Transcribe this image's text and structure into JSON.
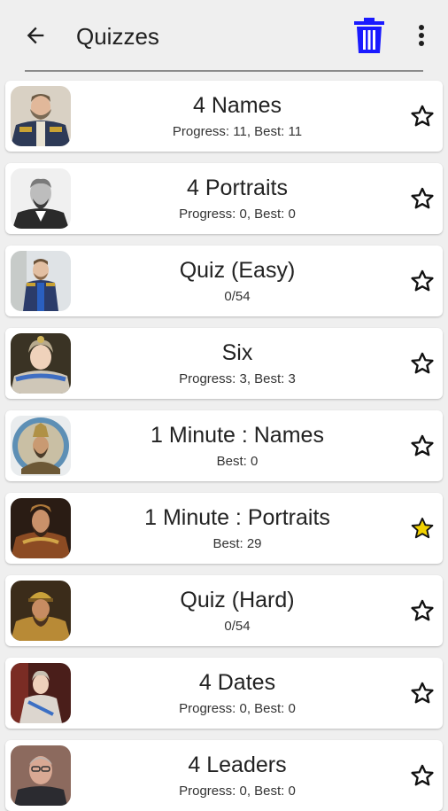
{
  "appbar": {
    "title": "Quizzes",
    "back_icon": "arrow-left-icon",
    "trash_icon": "trash-icon",
    "trash_color": "#1a1aff",
    "menu_icon": "more-vertical-icon"
  },
  "quizzes": [
    {
      "title": "4 Names",
      "subtitle": "Progress: 11, Best: 11",
      "favorite": false
    },
    {
      "title": "4 Portraits",
      "subtitle": "Progress: 0, Best: 0",
      "favorite": false
    },
    {
      "title": "Quiz (Easy)",
      "subtitle": "0/54",
      "favorite": false
    },
    {
      "title": "Six",
      "subtitle": "Progress: 3, Best: 3",
      "favorite": false
    },
    {
      "title": "1 Minute : Names",
      "subtitle": "Best: 0",
      "favorite": false
    },
    {
      "title": "1 Minute : Portraits",
      "subtitle": "Best: 29",
      "favorite": true
    },
    {
      "title": "Quiz (Hard)",
      "subtitle": "0/54",
      "favorite": false
    },
    {
      "title": "4 Dates",
      "subtitle": "Progress: 0, Best: 0",
      "favorite": false
    },
    {
      "title": "4 Leaders",
      "subtitle": "Progress: 0, Best: 0",
      "favorite": false
    }
  ],
  "colors": {
    "star_active": "#f2d200",
    "star_outline": "#111111"
  }
}
